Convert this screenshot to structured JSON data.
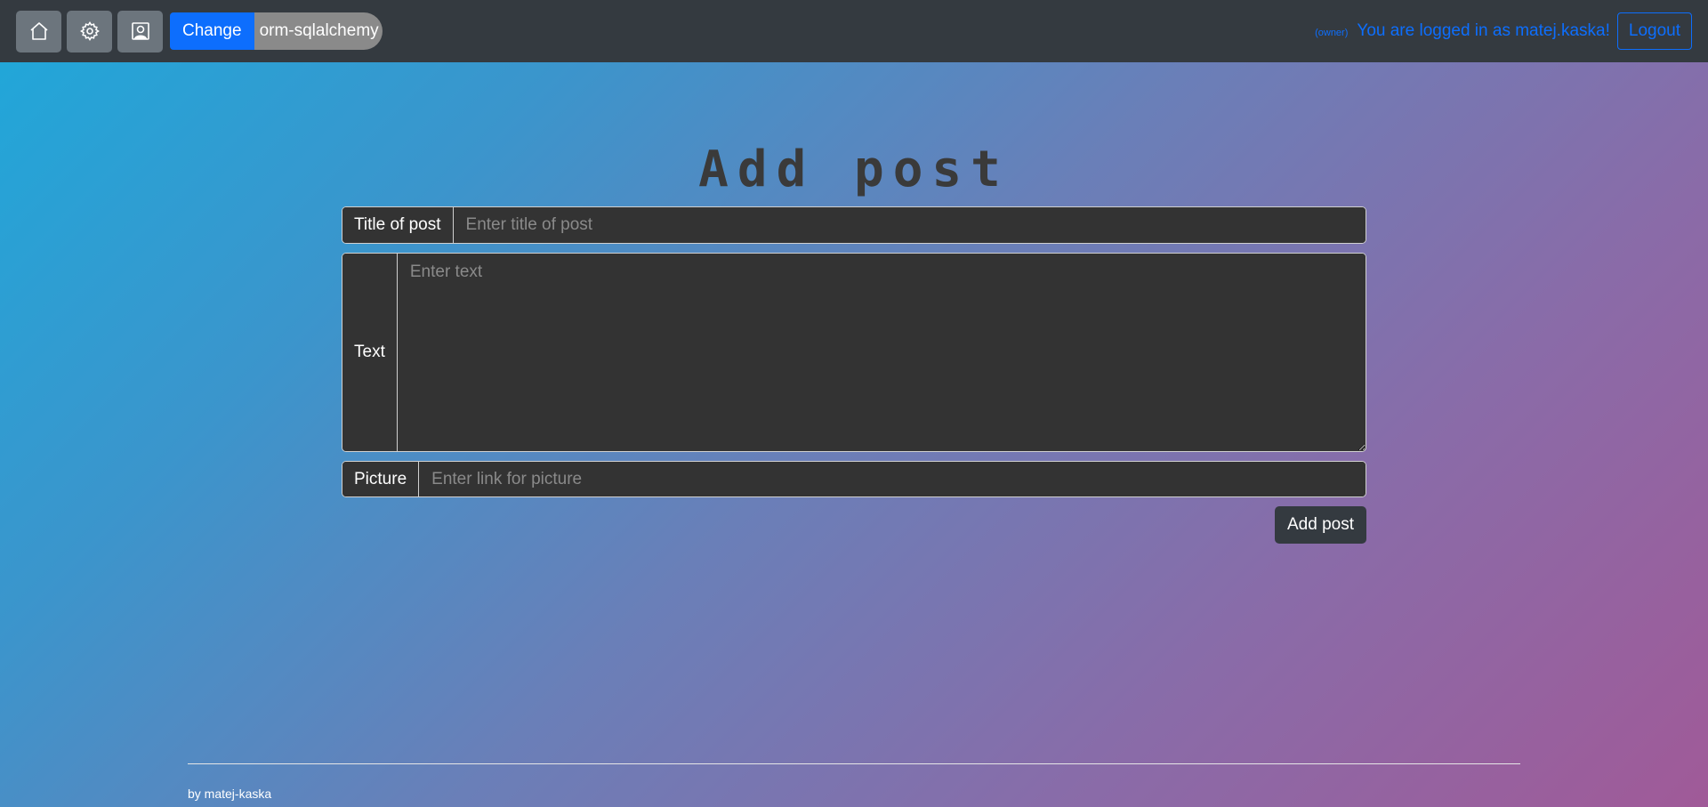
{
  "nav": {
    "home_icon": "home-icon",
    "settings_icon": "gear-icon",
    "profile_icon": "user-icon",
    "change_label": "Change",
    "db_label": "orm-sqlalchemy",
    "owner_tag": "(owner)",
    "logged_text": "You are logged in as matej.kaska!",
    "logout_label": "Logout"
  },
  "page": {
    "title": "Add post"
  },
  "form": {
    "title_label": "Title of post",
    "title_placeholder": "Enter title of post",
    "text_label": "Text",
    "text_placeholder": "Enter text",
    "picture_label": "Picture",
    "picture_placeholder": "Enter link for picture",
    "submit_label": "Add post"
  },
  "footer": {
    "text": "by matej-kaska"
  },
  "colors": {
    "accent": "#0d6efd",
    "navbar": "#343a40",
    "field_bg": "#333333"
  }
}
